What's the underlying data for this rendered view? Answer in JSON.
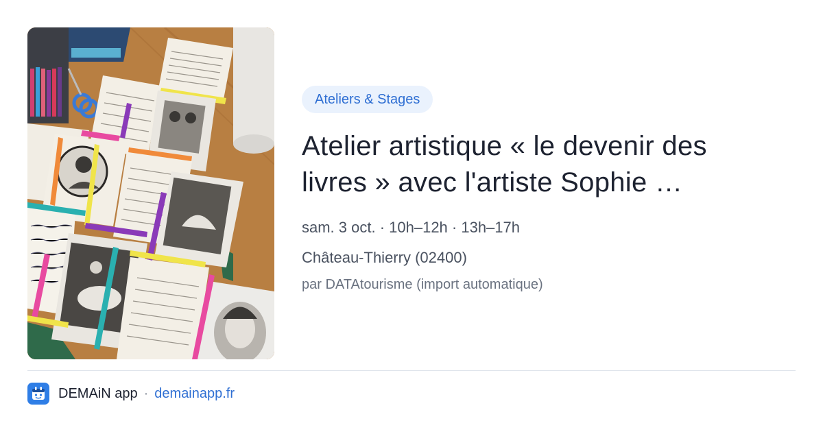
{
  "event": {
    "category": "Ateliers & Stages",
    "title_line1": "Atelier artistique « le devenir des",
    "title_line2": "livres » avec l'artiste Sophie …",
    "date": "sam. 3 oct. · 10h–12h · 13h–17h",
    "location": "Château-Thierry (02400)",
    "source": "par DATAtourisme (import automatique)"
  },
  "footer": {
    "app_name": "DEMAiN app",
    "separator": "·",
    "url": "demainapp.fr"
  },
  "icons": {
    "app_logo": "demain-app-logo-icon"
  },
  "colors": {
    "category_bg": "#eaf2fd",
    "category_text": "#2f6fd3",
    "brand_blue": "#2f7ee6",
    "title_text": "#1d2230"
  }
}
